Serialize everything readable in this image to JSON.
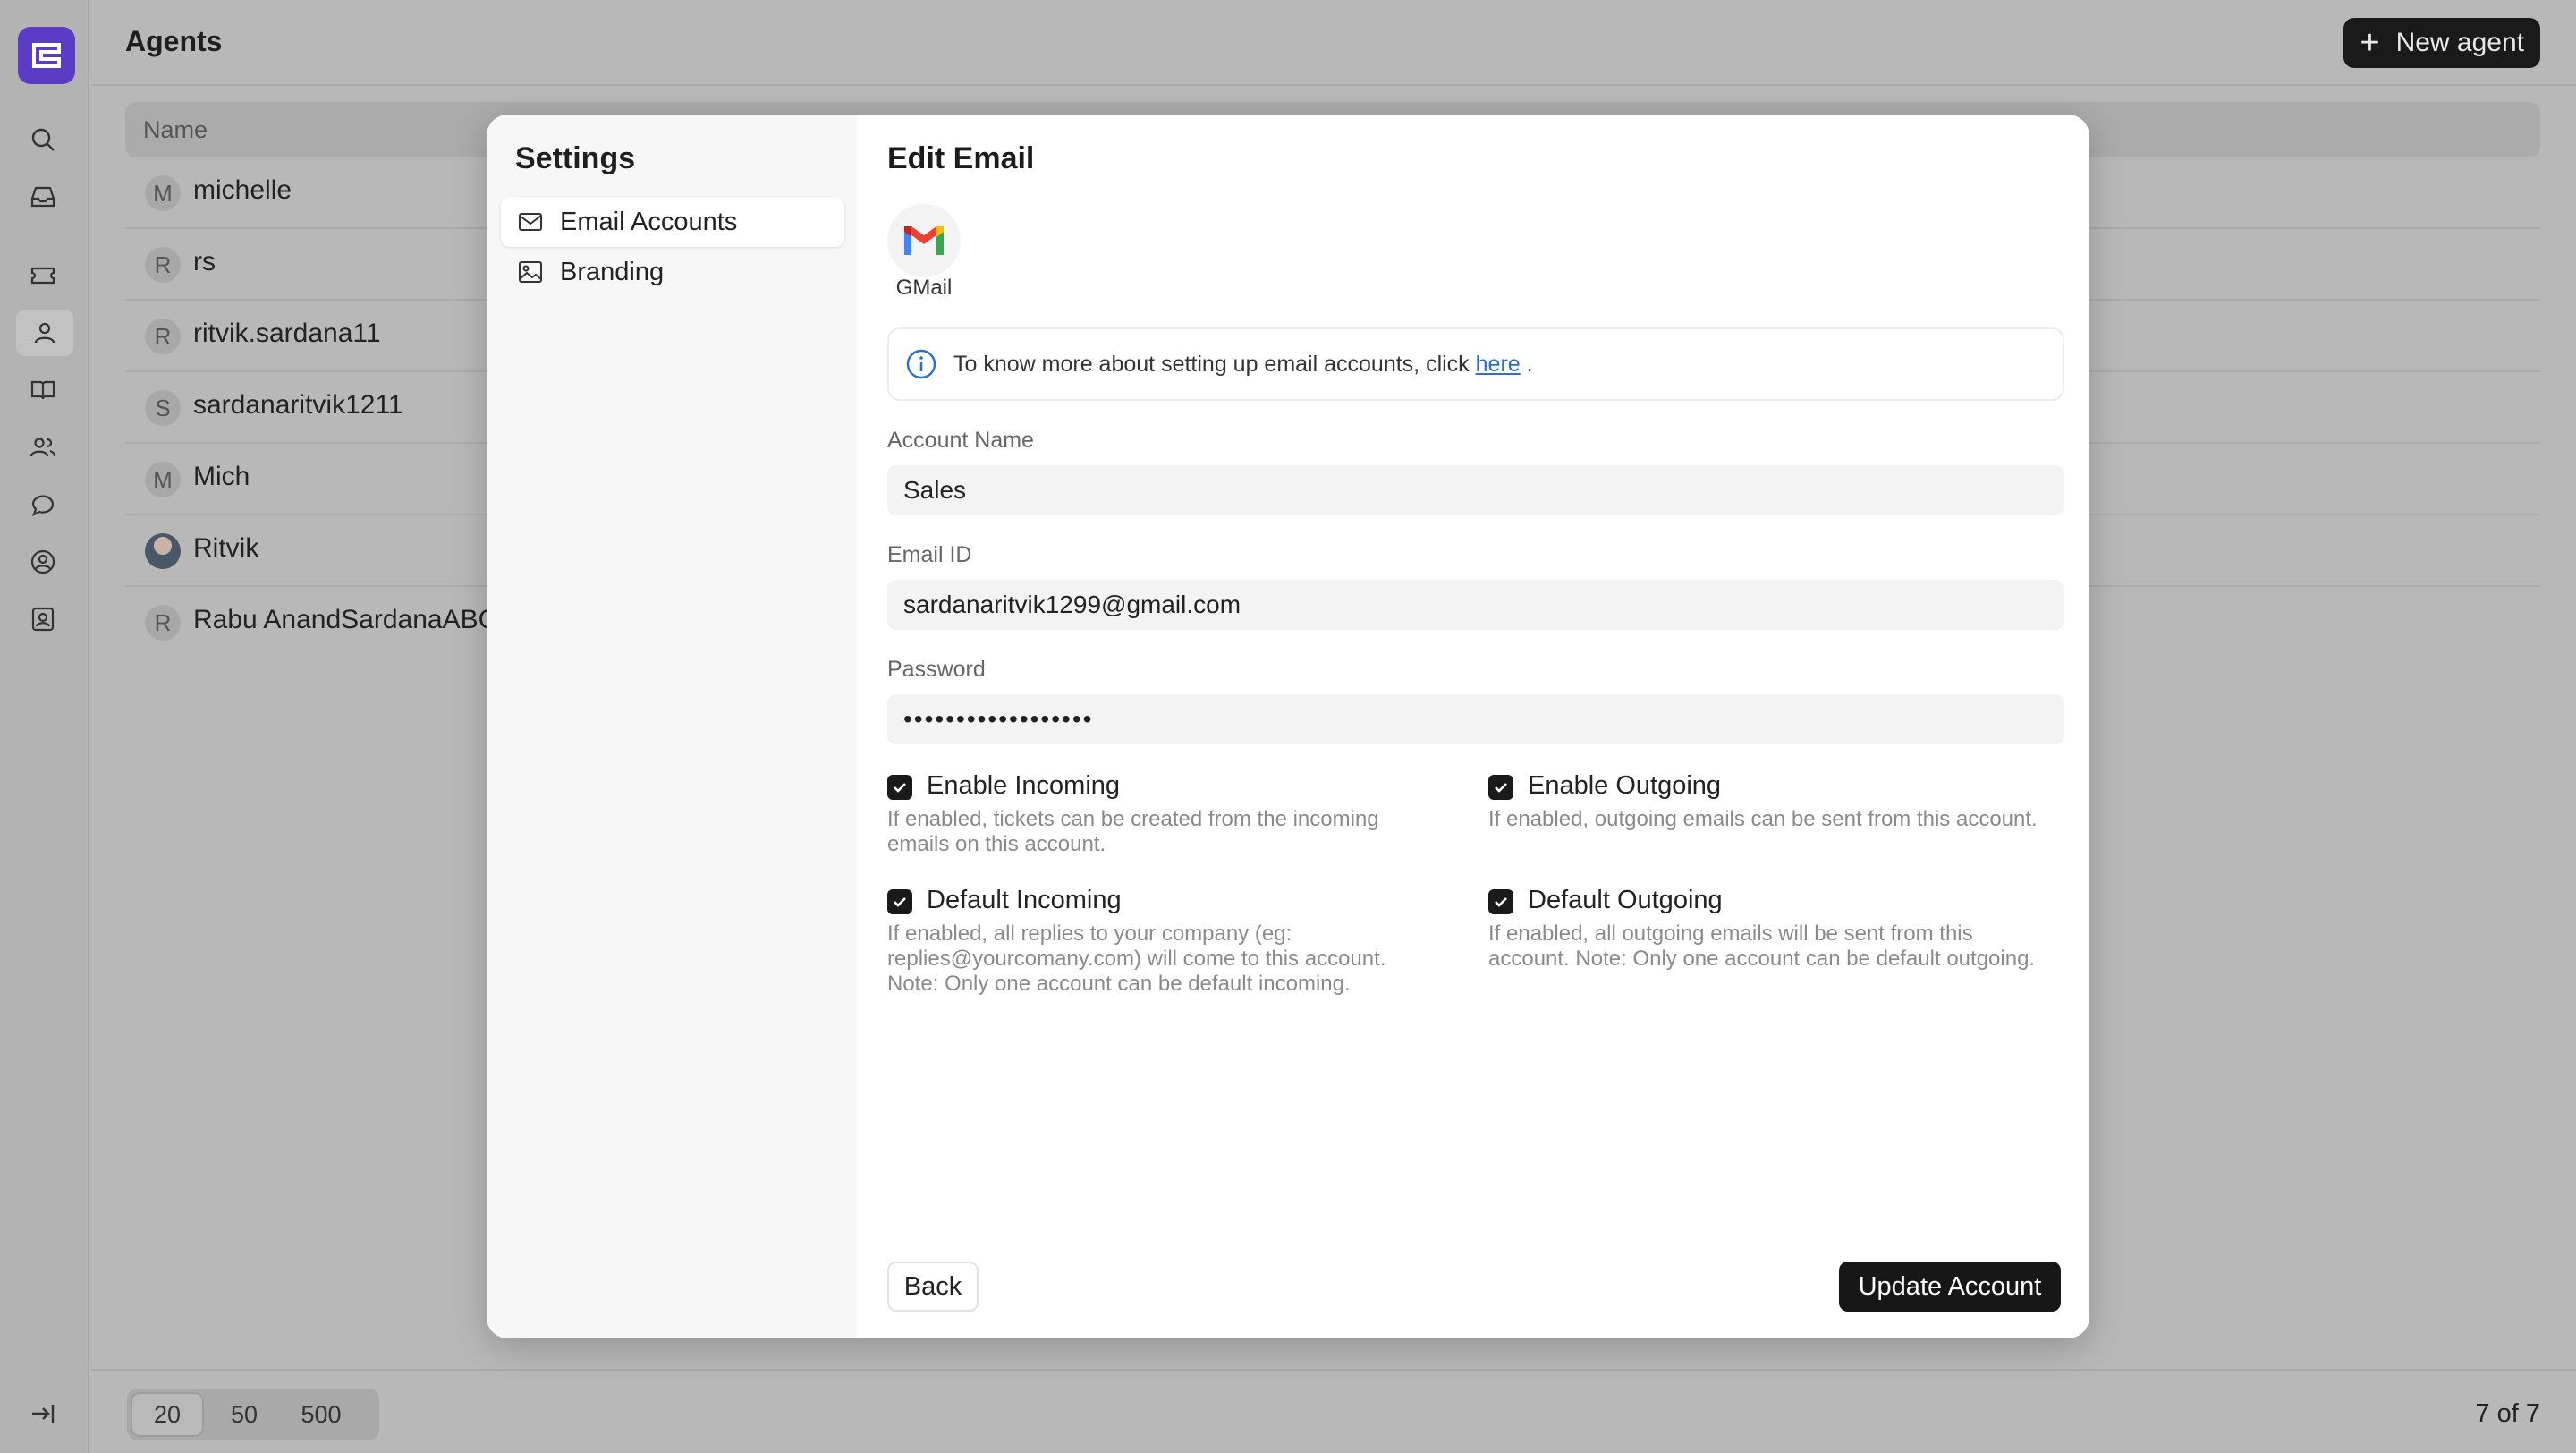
{
  "app": {
    "page_title": "Agents",
    "new_agent_label": "New agent",
    "brand_color": "#5b3cc4"
  },
  "rail": {
    "icons": [
      "search-icon",
      "inbox-icon",
      "ticket-icon",
      "agent-icon",
      "book-icon",
      "team-icon",
      "chat-icon",
      "user-circle-icon",
      "contact-icon",
      "logout-icon"
    ]
  },
  "list": {
    "column_name": "Name",
    "rows": [
      {
        "initial": "M",
        "name": "michelle"
      },
      {
        "initial": "R",
        "name": "rs"
      },
      {
        "initial": "R",
        "name": "ritvik.sardana11"
      },
      {
        "initial": "S",
        "name": "sardanaritvik1211"
      },
      {
        "initial": "M",
        "name": "Mich"
      },
      {
        "initial": "",
        "name": "Ritvik"
      },
      {
        "initial": "R",
        "name": "Rabu AnandSardanaABC"
      }
    ]
  },
  "footer": {
    "page_sizes": [
      "20",
      "50",
      "500"
    ],
    "count_text": "7 of 7"
  },
  "modal": {
    "settings_title": "Settings",
    "nav": [
      {
        "label": "Email Accounts",
        "icon": "mail-icon"
      },
      {
        "label": "Branding",
        "icon": "image-icon"
      }
    ],
    "edit_title": "Edit Email",
    "provider_label": "GMail",
    "info_text": "To know more about setting up email accounts, click",
    "info_link": "here",
    "info_suffix": ".",
    "account_name_label": "Account Name",
    "account_name_value": "Sales",
    "email_label": "Email ID",
    "email_value": "sardanaritvik1299@gmail.com",
    "password_label": "Password",
    "password_value": "••••••••••••••••••",
    "options": [
      {
        "label": "Enable Incoming",
        "desc": "If enabled, tickets can be created from the incoming emails on this account.",
        "checked": true
      },
      {
        "label": "Enable Outgoing",
        "desc": "If enabled, outgoing emails can be sent from this account.",
        "checked": true
      },
      {
        "label": "Default Incoming",
        "desc": "If enabled, all replies to your company (eg: replies@yourcomany.com) will come to this account. Note: Only one account can be default incoming.",
        "checked": true
      },
      {
        "label": "Default Outgoing",
        "desc": "If enabled, all outgoing emails will be sent from this account. Note: Only one account can be default outgoing.",
        "checked": true
      }
    ],
    "back_label": "Back",
    "update_label": "Update Account"
  }
}
